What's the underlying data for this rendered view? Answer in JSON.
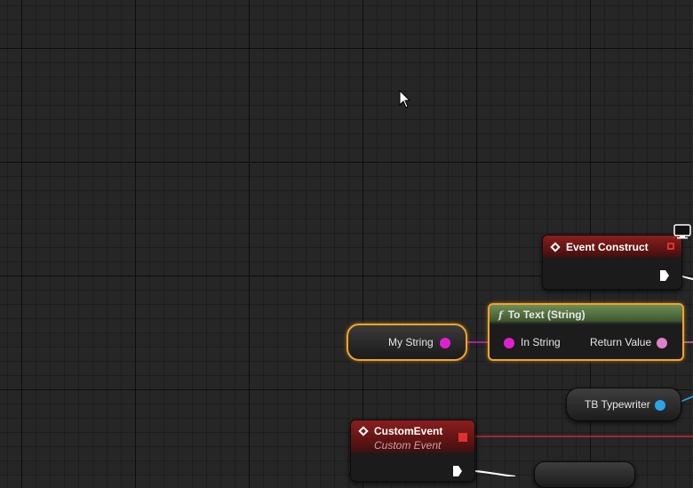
{
  "nodes": {
    "event_construct": {
      "title": "Event Construct"
    },
    "to_text": {
      "title": "To Text (String)",
      "input_label": "In String",
      "output_label": "Return Value"
    },
    "my_string": {
      "label": "My String"
    },
    "tb_typewriter": {
      "label": "TB Typewriter"
    },
    "custom_event": {
      "title": "CustomEvent",
      "subtitle": "Custom Event"
    }
  },
  "colors": {
    "string_pin": "#e020d0",
    "text_pin": "#e080c8",
    "object_pin": "#2aa6e8",
    "delegate_wire": "#c82828",
    "selection_outline": "#f3a525"
  },
  "icons": [
    "mouse-cursor-icon",
    "widget-screen-icon",
    "event-diamond-icon",
    "function-icon"
  ]
}
